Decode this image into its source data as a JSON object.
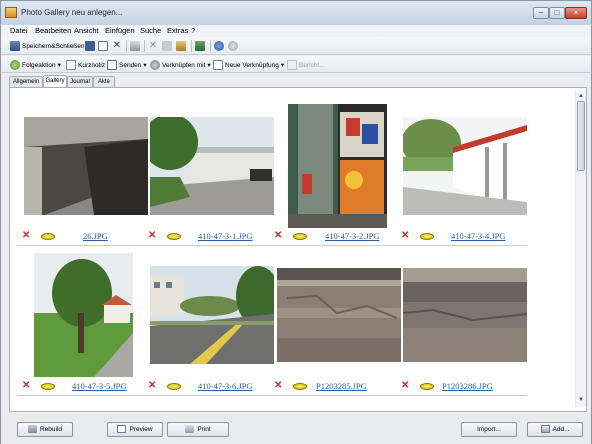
{
  "window": {
    "title": "Photo Gallery neu anlegen...",
    "controls": {
      "minimize": "–",
      "maximize": "□",
      "close": "×"
    }
  },
  "menu": [
    "Datei",
    "Bearbeiten",
    "Ansicht",
    "Einfügen",
    "Suche",
    "Extras",
    "?"
  ],
  "toolbar1": {
    "save_close": "Speichern&Schließen"
  },
  "toolbar2": {
    "followup": "Folgeaktion",
    "shortnote": "Kurznotiz",
    "send": "Senden",
    "link_with": "Verknüpfen mit",
    "new_link": "Neue Verknüpfung",
    "report": "Bericht..."
  },
  "tabs": [
    "Allgemein",
    "Gallery",
    "Journal",
    "Akte"
  ],
  "active_tab": "Gallery",
  "gallery": {
    "rows": [
      [
        "26.JPG",
        "410-47-3-1.JPG",
        "410-47-3-2.JPG",
        "410-47-3-4.JPG"
      ],
      [
        "410-47-3-5.JPG",
        "410-47-3-6.JPG",
        "P1203285.JPG",
        "P1203286.JPG"
      ]
    ],
    "delete_glyph": "✕"
  },
  "bottom": {
    "rebuild": "Rebuild",
    "preview": "Preview",
    "print": "Print",
    "import": "Import...",
    "add": "Add..."
  },
  "scroll_glyphs": {
    "up": "▲",
    "down": "▼"
  },
  "icons": {
    "app": "app-icon",
    "delete": "red-x-icon",
    "view": "magnifier-icon"
  }
}
